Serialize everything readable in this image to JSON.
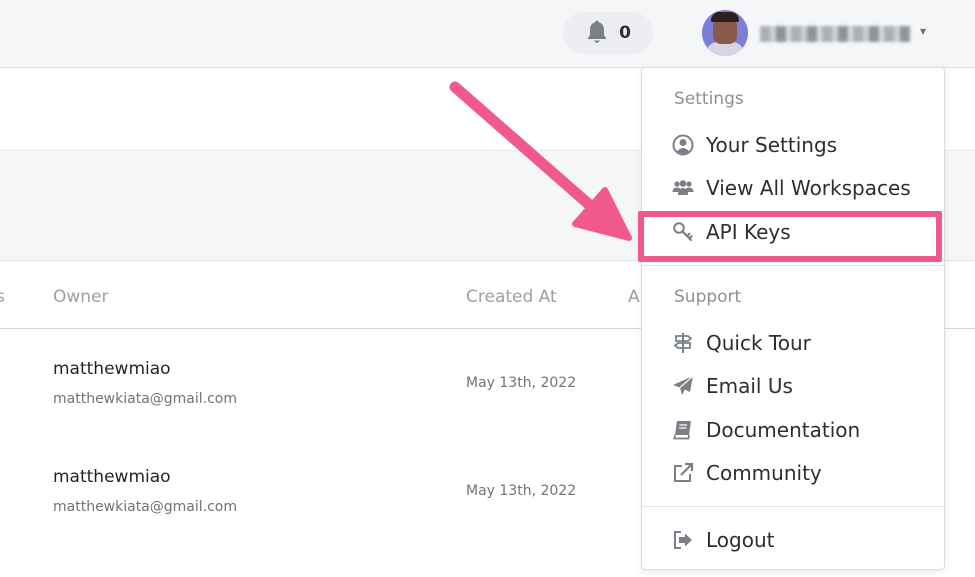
{
  "header": {
    "notification_count": "0",
    "notification_icon": "bell-icon",
    "user_caret": "▾"
  },
  "table": {
    "columns": [
      "s",
      "Owner",
      "Created At",
      "A"
    ],
    "rows": [
      {
        "owner_name": "matthewmiao",
        "owner_email": "matthewkiata@gmail.com",
        "created_at": "May 13th, 2022"
      },
      {
        "owner_name": "matthewmiao",
        "owner_email": "matthewkiata@gmail.com",
        "created_at": "May 13th, 2022"
      }
    ]
  },
  "dropdown": {
    "settings_label": "Settings",
    "settings_items": [
      {
        "label": "Your Settings",
        "icon": "user-circle-icon"
      },
      {
        "label": "View All Workspaces",
        "icon": "users-icon"
      },
      {
        "label": "API Keys",
        "icon": "key-icon"
      }
    ],
    "support_label": "Support",
    "support_items": [
      {
        "label": "Quick Tour",
        "icon": "directions-sign-icon"
      },
      {
        "label": "Email Us",
        "icon": "paper-plane-icon"
      },
      {
        "label": "Documentation",
        "icon": "book-icon"
      },
      {
        "label": "Community",
        "icon": "external-link-icon"
      }
    ],
    "logout": {
      "label": "Logout",
      "icon": "sign-out-icon"
    }
  },
  "colors": {
    "highlight": "#f0588e",
    "arrow": "#f0588e",
    "avatar_bg": "#7b7fd8"
  }
}
